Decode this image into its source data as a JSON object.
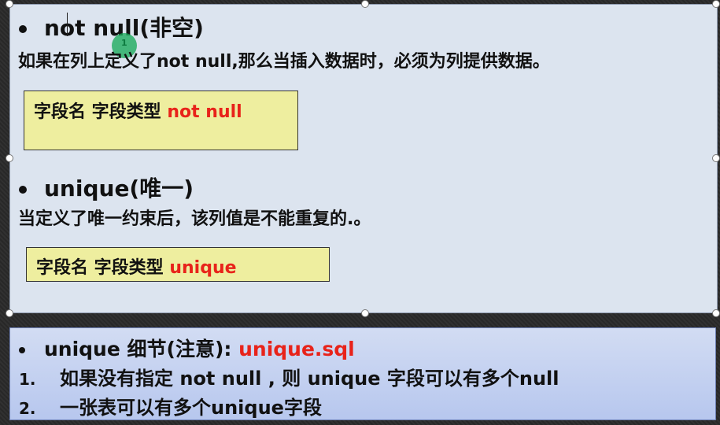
{
  "slide": {
    "not_null": {
      "title": "not null(非空)",
      "description": "如果在列上定义了not null,那么当插入数据时，必须为列提供数据。",
      "syntax_prefix": "字段名 字段类型",
      "syntax_keyword": "not null"
    },
    "unique": {
      "title": "unique(唯一)",
      "description": "当定义了唯一约束后，该列值是不能重复的.。",
      "syntax_prefix": "字段名 字段类型",
      "syntax_keyword": "unique"
    },
    "details": {
      "title": "unique 细节(注意):",
      "file": "unique.sql",
      "items": [
        {
          "num": "1.",
          "text": "如果没有指定 not null , 则 unique 字段可以有多个null"
        },
        {
          "num": "2.",
          "text": "一张表可以有多个unique字段"
        }
      ]
    }
  },
  "cursor_badge": "1",
  "colors": {
    "panel_top": "#dce4ef",
    "code_box": "#eeee9f",
    "keyword_red": "#e8231a",
    "panel_bottom": "#c2cff2"
  }
}
